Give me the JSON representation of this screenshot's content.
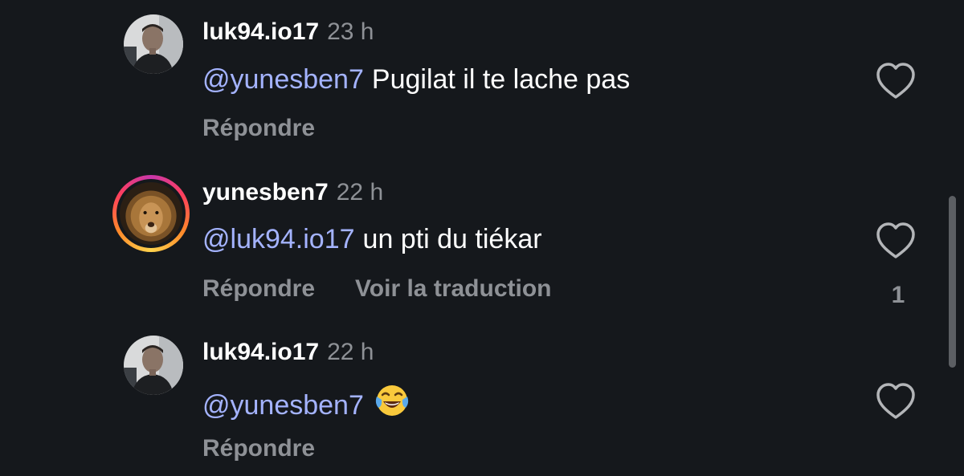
{
  "comments": [
    {
      "username": "luk94.io17",
      "time": "23 h",
      "mention": "@yunesben7",
      "text": "Pugilat il te lache pas",
      "reply_label": "Répondre",
      "avatar_icon": "man-portrait-avatar"
    },
    {
      "username": "yunesben7",
      "time": "22 h",
      "mention": "@luk94.io17",
      "text": "un pti du tiékar",
      "reply_label": "Répondre",
      "translate_label": "Voir la traduction",
      "like_count": "1",
      "avatar_icon": "lion-avatar",
      "story_ring": true
    },
    {
      "username": "luk94.io17",
      "time": "22 h",
      "mention": "@yunesben7",
      "text": "",
      "emoji": "face-with-tears-of-joy",
      "reply_label": "Répondre",
      "avatar_icon": "man-portrait-avatar"
    }
  ],
  "colors": {
    "background": "#15181c",
    "username": "#ffffff",
    "meta": "#8e9196",
    "mention": "#a4b3ff"
  },
  "icons": {
    "like": "heart-outline-icon",
    "emoji": "face-with-tears-of-joy"
  }
}
